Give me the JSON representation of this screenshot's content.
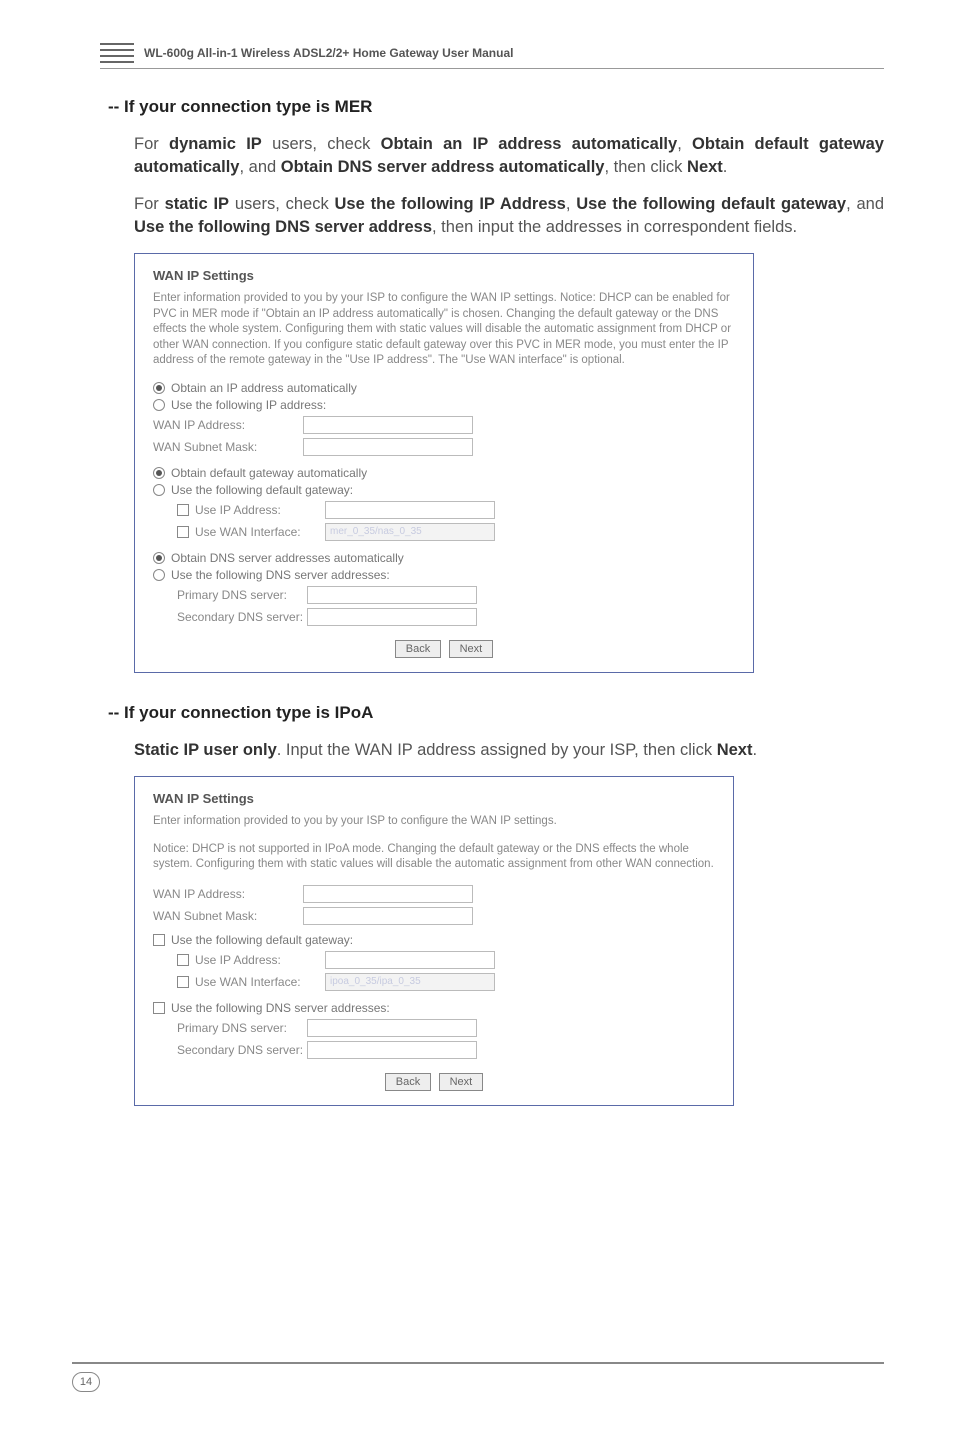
{
  "header": {
    "title": "WL-600g All-in-1 Wireless ADSL2/2+ Home Gateway User Manual"
  },
  "section1": {
    "heading": "-- If your connection type is MER",
    "para1_pre": "For ",
    "para1_b1": "dynamic IP",
    "para1_mid1": " users, check ",
    "para1_b2": "Obtain an IP address automatically",
    "para1_mid2": ", ",
    "para1_b3": "Obtain default gateway automatically",
    "para1_mid3": ", and ",
    "para1_b4": "Obtain DNS server address automatically",
    "para1_mid4": ", then click ",
    "para1_b5": "Next",
    "para1_end": ".",
    "para2_pre": "For ",
    "para2_b1": "static IP",
    "para2_mid1": " users, check ",
    "para2_b2": "Use the following IP Address",
    "para2_mid2": ", ",
    "para2_b3": "Use the following default gateway",
    "para2_mid3": ", and ",
    "para2_b4": "Use the following DNS server address",
    "para2_mid4": ", then input the addresses in correspondent fields."
  },
  "panel1": {
    "title": "WAN IP Settings",
    "desc": "Enter information provided to you by your ISP to configure the WAN IP settings. Notice: DHCP can be enabled for PVC in MER mode if \"Obtain an IP address automatically\" is chosen. Changing the default gateway or the DNS effects the whole system. Configuring them with static values will disable the automatic assignment from DHCP or other WAN connection. If you configure static default gateway over this PVC in MER mode, you must enter the IP address of the remote gateway in the \"Use IP address\". The \"Use WAN interface\" is optional.",
    "r1": "Obtain an IP address automatically",
    "r2": "Use the following IP address:",
    "f1": "WAN IP Address:",
    "f2": "WAN Subnet Mask:",
    "r3": "Obtain default gateway automatically",
    "r4": "Use the following default gateway:",
    "f3": "Use IP Address:",
    "f4": "Use WAN Interface:",
    "f4val": "mer_0_35/nas_0_35",
    "r5": "Obtain DNS server addresses automatically",
    "r6": "Use the following DNS server addresses:",
    "f5": "Primary DNS server:",
    "f6": "Secondary DNS server:",
    "btnBack": "Back",
    "btnNext": "Next"
  },
  "section2": {
    "heading": "-- If your connection type is IPoA",
    "para1_b1": "Static IP user only",
    "para1_mid1": ". Input the WAN IP address assigned by your ISP, then click ",
    "para1_b2": "Next",
    "para1_end": "."
  },
  "panel2": {
    "title": "WAN IP Settings",
    "desc1": "Enter information provided to you by your ISP to configure the WAN IP settings.",
    "desc2": "Notice: DHCP is not supported in IPoA mode. Changing the default gateway or the DNS effects the whole system. Configuring them with static values will disable the automatic assignment from other WAN connection.",
    "f1": "WAN IP Address:",
    "f2": "WAN Subnet Mask:",
    "c1": "Use the following default gateway:",
    "f3": "Use IP Address:",
    "f4": "Use WAN Interface:",
    "f4val": "ipoa_0_35/ipa_0_35",
    "c2": "Use the following DNS server addresses:",
    "f5": "Primary DNS server:",
    "f6": "Secondary DNS server:",
    "btnBack": "Back",
    "btnNext": "Next"
  },
  "footer": {
    "page": "14"
  }
}
